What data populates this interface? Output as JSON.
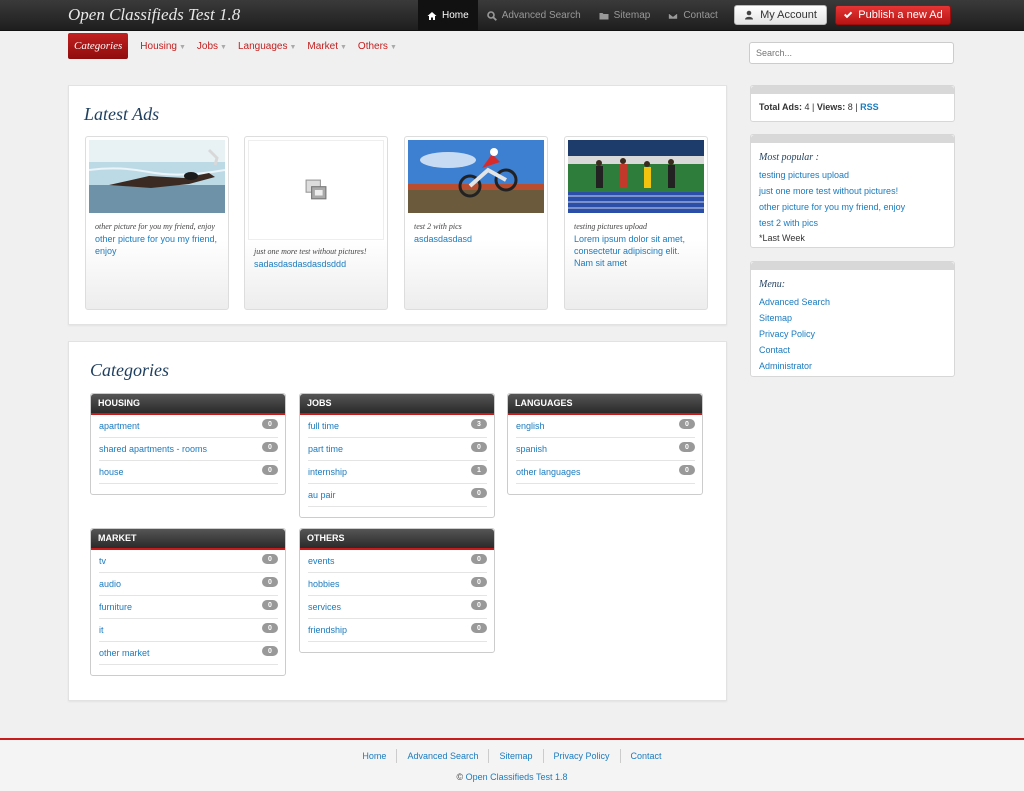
{
  "header": {
    "brand": "Open Classifieds Test 1.8",
    "nav": [
      {
        "label": "Home",
        "icon": "home-icon",
        "active": true
      },
      {
        "label": "Advanced Search",
        "icon": "search-icon"
      },
      {
        "label": "Sitemap",
        "icon": "folder-icon"
      },
      {
        "label": "Contact",
        "icon": "envelope-icon"
      }
    ],
    "account_label": "My Account",
    "publish_label": "Publish a new Ad",
    "accent_color": "#c81c1c"
  },
  "subnav": {
    "categories_label": "Categories",
    "items": [
      "Housing",
      "Jobs",
      "Languages",
      "Market",
      "Others"
    ]
  },
  "search": {
    "placeholder": "Search..."
  },
  "latest": {
    "title": "Latest Ads",
    "ads": [
      {
        "category": "other picture for you my friend, enjoy",
        "title": "other picture for you my friend, enjoy",
        "image": "swimmer"
      },
      {
        "category": "just one more test without pictures!",
        "title": "sadasdasdasdasdsddd",
        "image": "no-image-icon"
      },
      {
        "category": "test 2 with pics",
        "title": "asdasdasdasd",
        "image": "motocross"
      },
      {
        "category": "testing pictures upload",
        "title": "Lorem ipsum dolor sit amet, consectetur adipiscing elit. Nam sit amet",
        "image": "track-race"
      }
    ]
  },
  "categories": {
    "title": "Categories",
    "groups": [
      {
        "name": "HOUSING",
        "items": [
          {
            "label": "apartment",
            "count": "0"
          },
          {
            "label": "shared apartments - rooms",
            "count": "0"
          },
          {
            "label": "house",
            "count": "0"
          }
        ]
      },
      {
        "name": "JOBS",
        "items": [
          {
            "label": "full time",
            "count": "3"
          },
          {
            "label": "part time",
            "count": "0"
          },
          {
            "label": "internship",
            "count": "1"
          },
          {
            "label": "au pair",
            "count": "0"
          }
        ]
      },
      {
        "name": "LANGUAGES",
        "items": [
          {
            "label": "english",
            "count": "0"
          },
          {
            "label": "spanish",
            "count": "0"
          },
          {
            "label": "other languages",
            "count": "0"
          }
        ]
      },
      {
        "name": "MARKET",
        "items": [
          {
            "label": "tv",
            "count": "0"
          },
          {
            "label": "audio",
            "count": "0"
          },
          {
            "label": "furniture",
            "count": "0"
          },
          {
            "label": "it",
            "count": "0"
          },
          {
            "label": "other market",
            "count": "0"
          }
        ]
      },
      {
        "name": "OTHERS",
        "items": [
          {
            "label": "events",
            "count": "0"
          },
          {
            "label": "hobbies",
            "count": "0"
          },
          {
            "label": "services",
            "count": "0"
          },
          {
            "label": "friendship",
            "count": "0"
          }
        ]
      }
    ]
  },
  "sidebar": {
    "stats": {
      "total_label": "Total Ads:",
      "total": "4",
      "views_label": "Views:",
      "views": "8",
      "sep": "|",
      "rss": "RSS"
    },
    "popular": {
      "title": "Most popular :",
      "items": [
        "testing pictures upload",
        "just one more test without pictures!",
        "other picture for you my friend, enjoy",
        "test 2 with pics"
      ],
      "period": "*Last Week"
    },
    "menu": {
      "title": "Menu:",
      "items": [
        "Advanced Search",
        "Sitemap",
        "Privacy Policy",
        "Contact",
        "Administrator"
      ]
    }
  },
  "footer": {
    "links": [
      "Home",
      "Advanced Search",
      "Sitemap",
      "Privacy Policy",
      "Contact"
    ],
    "copyright_symbol": "©",
    "copyright_name": "Open Classifieds Test 1.8"
  }
}
